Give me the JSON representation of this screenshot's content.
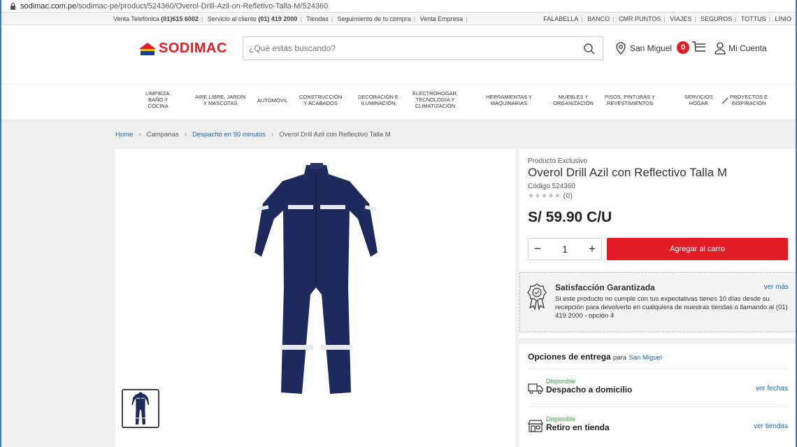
{
  "browser": {
    "url_domain": "sodimac.com.pe",
    "url_path": "/sodimac-pe/product/524360/Overol-Drill-Azil-on-Refletivo-Talla-M/524360"
  },
  "topbar": {
    "venta_label": "Venta Telefónica",
    "venta_phone": "(01)615 6002",
    "servicio_label": "Servicio al cliente",
    "servicio_phone": "(01) 419 2000",
    "tiendas": "Tiendas",
    "seguimiento": "Seguimiento de tu compra",
    "empresa": "Venta Empresa",
    "brands": [
      "FALABELLA",
      "BANCO",
      "CMR PUNTOS",
      "VIAJES",
      "SEGUROS",
      "TOTTUS",
      "LINIO"
    ]
  },
  "header": {
    "logo_text": "SODIMAC",
    "search_placeholder": "¿Qué estás buscando?",
    "location": "San Miguel",
    "cart_count": "0",
    "account": "Mi Cuenta"
  },
  "nav": {
    "items": [
      {
        "lines": [
          "LIMPIEZA,",
          "BAÑO Y",
          "COCINA"
        ]
      },
      {
        "lines": [
          "AIRE LIBRE, JARDÍN",
          "Y MASCOTAS"
        ]
      },
      {
        "lines": [
          "AUTOMÓVIL"
        ]
      },
      {
        "lines": [
          "CONSTRUCCIÓN",
          "Y ACABADOS"
        ]
      },
      {
        "lines": [
          "DECORACIÓN E",
          "ILUMINACIÓN"
        ]
      },
      {
        "lines": [
          "ELECTROHOGAR,",
          "TECNOLOGÍA Y",
          "CLIMATIZACIÓN"
        ]
      },
      {
        "lines": [
          "HERRAMIENTAS Y",
          "MAQUINARIAS"
        ]
      },
      {
        "lines": [
          "MUEBLES Y",
          "ORGANIZACIÓN"
        ]
      },
      {
        "lines": [
          "PISOS, PINTURAS Y",
          "REVESTIMIENTOS"
        ]
      },
      {
        "lines": [
          "SERVICIOS",
          "HOGAR"
        ]
      },
      {
        "lines": [
          "PROYECTOS E",
          "INSPIRACIÓN"
        ]
      }
    ]
  },
  "breadcrumb": {
    "home": "Home",
    "campanas": "Campanas",
    "despacho": "Despacho en 90 minutos",
    "current": "Overol Drill Azil con Reflectivo Talla M"
  },
  "product": {
    "exclusive": "Producto Exclusivo",
    "title": "Overol Drill Azil con Reflectivo Talla M",
    "code": "Código 524360",
    "stars": "★★★★★",
    "review_count": "(0)",
    "rating": 0,
    "price": "S/ 59.90 C/U",
    "qty": "1",
    "minus": "−",
    "plus": "+",
    "add_to_cart": "Agregar al carro",
    "image_color": "#1f2a5c"
  },
  "satisfaction": {
    "title": "Satisfacción Garantizada",
    "more": "ver más",
    "text": "Si este producto no cumple con tus expectativas tienes 10 días desde su recepción para devolverlo en cualquiera de nuestras tiendas o llamando al (01) 419 2000 - opción 4"
  },
  "delivery": {
    "title": "Opciones de entrega",
    "para": "para",
    "city": "San Miguel",
    "options": [
      {
        "status": "Disponible",
        "name": "Despacho a domicilio",
        "link": "ver fechas"
      },
      {
        "status": "Disponible",
        "name": "Retiro en tienda",
        "link": "ver tiendas"
      }
    ]
  },
  "colors": {
    "brand_red": "#e11c24",
    "link_blue": "#1a64b8",
    "available_green": "#3c9a3c"
  }
}
